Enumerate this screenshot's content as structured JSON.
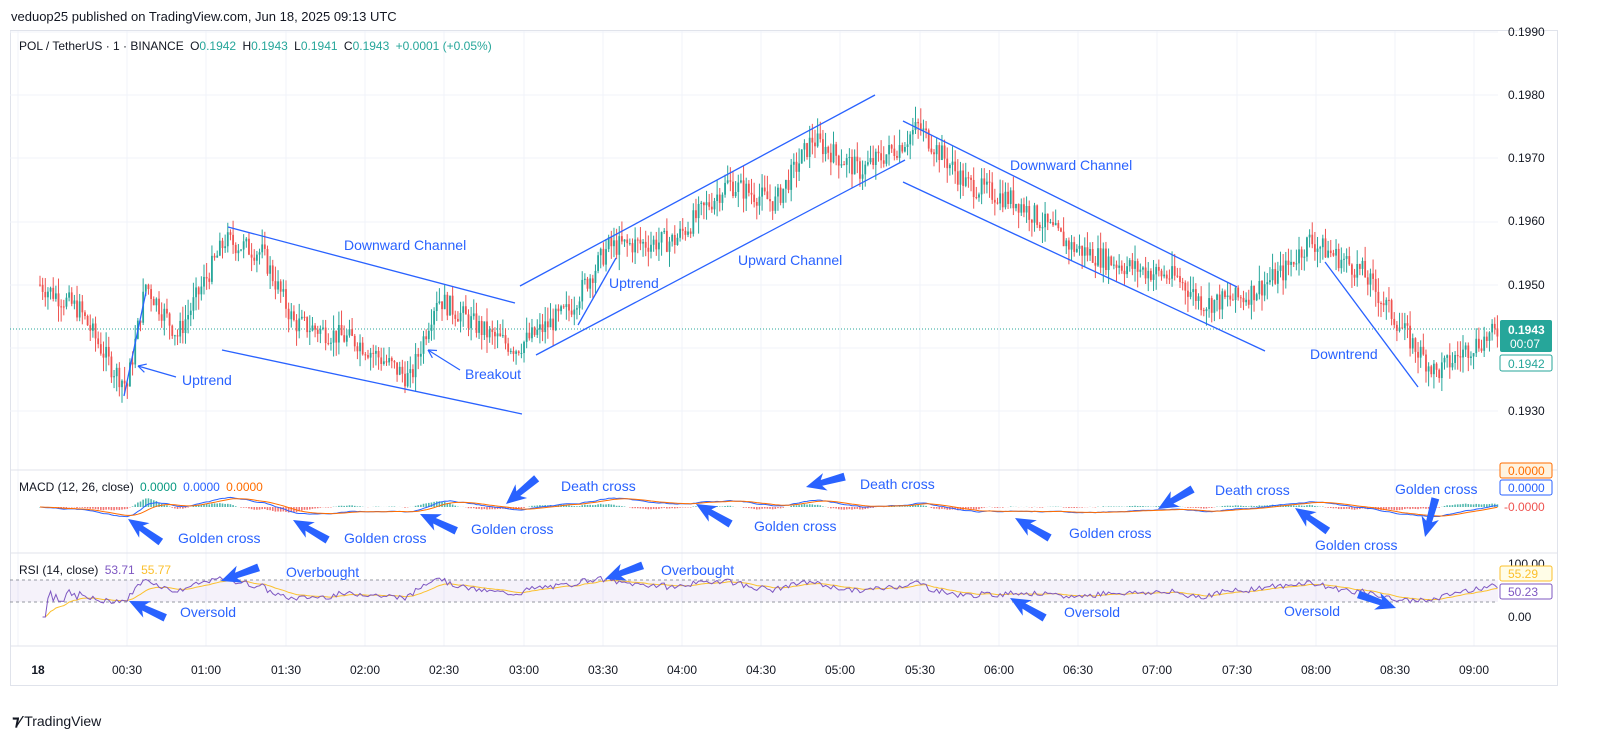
{
  "header": {
    "published": "veduop25 published on TradingView.com, Jun 18, 2025 09:13 UTC"
  },
  "footer": {
    "brand": "TradingView"
  },
  "price_legend": {
    "symbol": "POL / TetherUS · 1 · BINANCE",
    "o_label": "O",
    "o": "0.1942",
    "h_label": "H",
    "h": "0.1943",
    "l_label": "L",
    "l": "0.1941",
    "c_label": "C",
    "c": "0.1943",
    "change": "+0.0001 (+0.05%)"
  },
  "macd_legend": {
    "label": "MACD (12, 26, close)",
    "v1": "0.0000",
    "v2": "0.0000",
    "v3": "0.0000"
  },
  "rsi_legend": {
    "label": "RSI (14, close)",
    "v1": "53.71",
    "v2": "55.77"
  },
  "price_axis": {
    "ticks": [
      "0.1990",
      "0.1980",
      "0.1970",
      "0.1960",
      "0.1950",
      "0.1930"
    ],
    "last_price": "0.1943",
    "countdown": "00:07",
    "prev_price": "0.1942"
  },
  "macd_axis": {
    "top": "0.0000",
    "mid": "0.0000",
    "low": "-0.0000"
  },
  "rsi_axis": {
    "top": "100.00",
    "a": "55.29",
    "b": "50.23",
    "bottom": "0.00"
  },
  "time_axis": [
    "18",
    "00:30",
    "01:00",
    "01:30",
    "02:00",
    "02:30",
    "03:00",
    "03:30",
    "04:00",
    "04:30",
    "05:00",
    "05:30",
    "06:00",
    "06:30",
    "07:00",
    "07:30",
    "08:00",
    "08:30",
    "09:00"
  ],
  "annotations": {
    "downward_channel_1": "Downward Channel",
    "upward_channel": "Upward Channel",
    "downward_channel_2": "Downward Channel",
    "uptrend_1": "Uptrend",
    "uptrend_2": "Uptrend",
    "breakout": "Breakout",
    "downtrend": "Downtrend",
    "golden_cross_1": "Golden cross",
    "golden_cross_2": "Golden cross",
    "golden_cross_3": "Golden cross",
    "golden_cross_4": "Golden cross",
    "golden_cross_5": "Golden cross",
    "golden_cross_6": "Golden cross",
    "golden_cross_7": "Golden cross",
    "death_cross_1": "Death cross",
    "death_cross_2": "Death cross",
    "death_cross_3": "Death cross",
    "overbought_1": "Overbought",
    "overbought_2": "Overbought",
    "oversold_1": "Oversold",
    "oversold_2": "Oversold",
    "oversold_3": "Oversold"
  },
  "colors": {
    "up": "#26a69a",
    "down": "#ef5350",
    "annotation": "#2962ff",
    "macd": "#2962ff",
    "signal": "#ff6d00",
    "rsi": "#7e57c2",
    "rsi_ma": "#fbc02d",
    "last_price_bg": "#26a69a"
  },
  "chart_data": {
    "type": "candlestick",
    "title": "POL / TetherUS · 1 · BINANCE",
    "y_range": [
      0.1921,
      0.199
    ],
    "x_range": [
      "00:00",
      "09:13"
    ],
    "ohlc_current": {
      "open": 0.1942,
      "high": 0.1943,
      "low": 0.1941,
      "close": 0.1943
    },
    "close_path": [
      {
        "t": "00:00",
        "v": 0.195
      },
      {
        "t": "00:15",
        "v": 0.1946
      },
      {
        "t": "00:27",
        "v": 0.1937
      },
      {
        "t": "00:33",
        "v": 0.1934
      },
      {
        "t": "00:40",
        "v": 0.195
      },
      {
        "t": "00:52",
        "v": 0.1942
      },
      {
        "t": "01:10",
        "v": 0.1957
      },
      {
        "t": "01:24",
        "v": 0.1955
      },
      {
        "t": "01:36",
        "v": 0.1944
      },
      {
        "t": "02:00",
        "v": 0.1941
      },
      {
        "t": "02:20",
        "v": 0.1935
      },
      {
        "t": "02:30",
        "v": 0.1948
      },
      {
        "t": "02:50",
        "v": 0.1942
      },
      {
        "t": "03:00",
        "v": 0.194
      },
      {
        "t": "03:20",
        "v": 0.1946
      },
      {
        "t": "03:35",
        "v": 0.1956
      },
      {
        "t": "04:00",
        "v": 0.1957
      },
      {
        "t": "04:20",
        "v": 0.1966
      },
      {
        "t": "04:38",
        "v": 0.1963
      },
      {
        "t": "04:52",
        "v": 0.1973
      },
      {
        "t": "05:10",
        "v": 0.1968
      },
      {
        "t": "05:25",
        "v": 0.1972
      },
      {
        "t": "05:32",
        "v": 0.1975
      },
      {
        "t": "05:50",
        "v": 0.1966
      },
      {
        "t": "06:10",
        "v": 0.1963
      },
      {
        "t": "06:30",
        "v": 0.1956
      },
      {
        "t": "06:50",
        "v": 0.1953
      },
      {
        "t": "07:10",
        "v": 0.1951
      },
      {
        "t": "07:20",
        "v": 0.1947
      },
      {
        "t": "07:35",
        "v": 0.1948
      },
      {
        "t": "07:50",
        "v": 0.1952
      },
      {
        "t": "08:00",
        "v": 0.1957
      },
      {
        "t": "08:20",
        "v": 0.1952
      },
      {
        "t": "08:40",
        "v": 0.194
      },
      {
        "t": "08:48",
        "v": 0.1936
      },
      {
        "t": "09:00",
        "v": 0.194
      },
      {
        "t": "09:13",
        "v": 0.1943
      }
    ]
  }
}
